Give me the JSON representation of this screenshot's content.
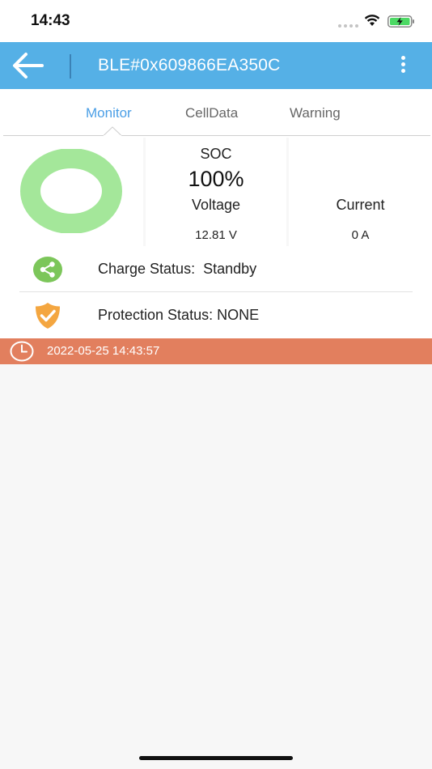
{
  "status_bar": {
    "time": "14:43"
  },
  "app_bar": {
    "title": "BLE#0x609866EA350C"
  },
  "tabs": [
    {
      "label": "Monitor",
      "active": true
    },
    {
      "label": "CellData",
      "active": false
    },
    {
      "label": "Warning",
      "active": false
    }
  ],
  "monitor": {
    "soc_label": "SOC",
    "soc_value": "100%",
    "soc_level_percent": 100,
    "voltage_label": "Voltage",
    "voltage_value": "12.81 V",
    "current_label": "Current",
    "current_value": "0 A"
  },
  "status": {
    "charge_text": "Charge Status:  Standby",
    "protection_text": "Protection Status: NONE"
  },
  "timestamp": "2022-05-25 14:43:57",
  "colors": {
    "app_bar": "#55b0e6",
    "active_tab": "#4a9ee6",
    "soc_ring": "#a4e79a",
    "charge_icon": "#7cc65a",
    "protection_icon": "#f4a640",
    "time_bar": "#e27f5e"
  },
  "icons": {
    "back": "arrow-left-icon",
    "menu": "more-vertical-icon",
    "charge": "share-icon",
    "protection": "shield-check-icon",
    "clock": "clock-icon"
  }
}
